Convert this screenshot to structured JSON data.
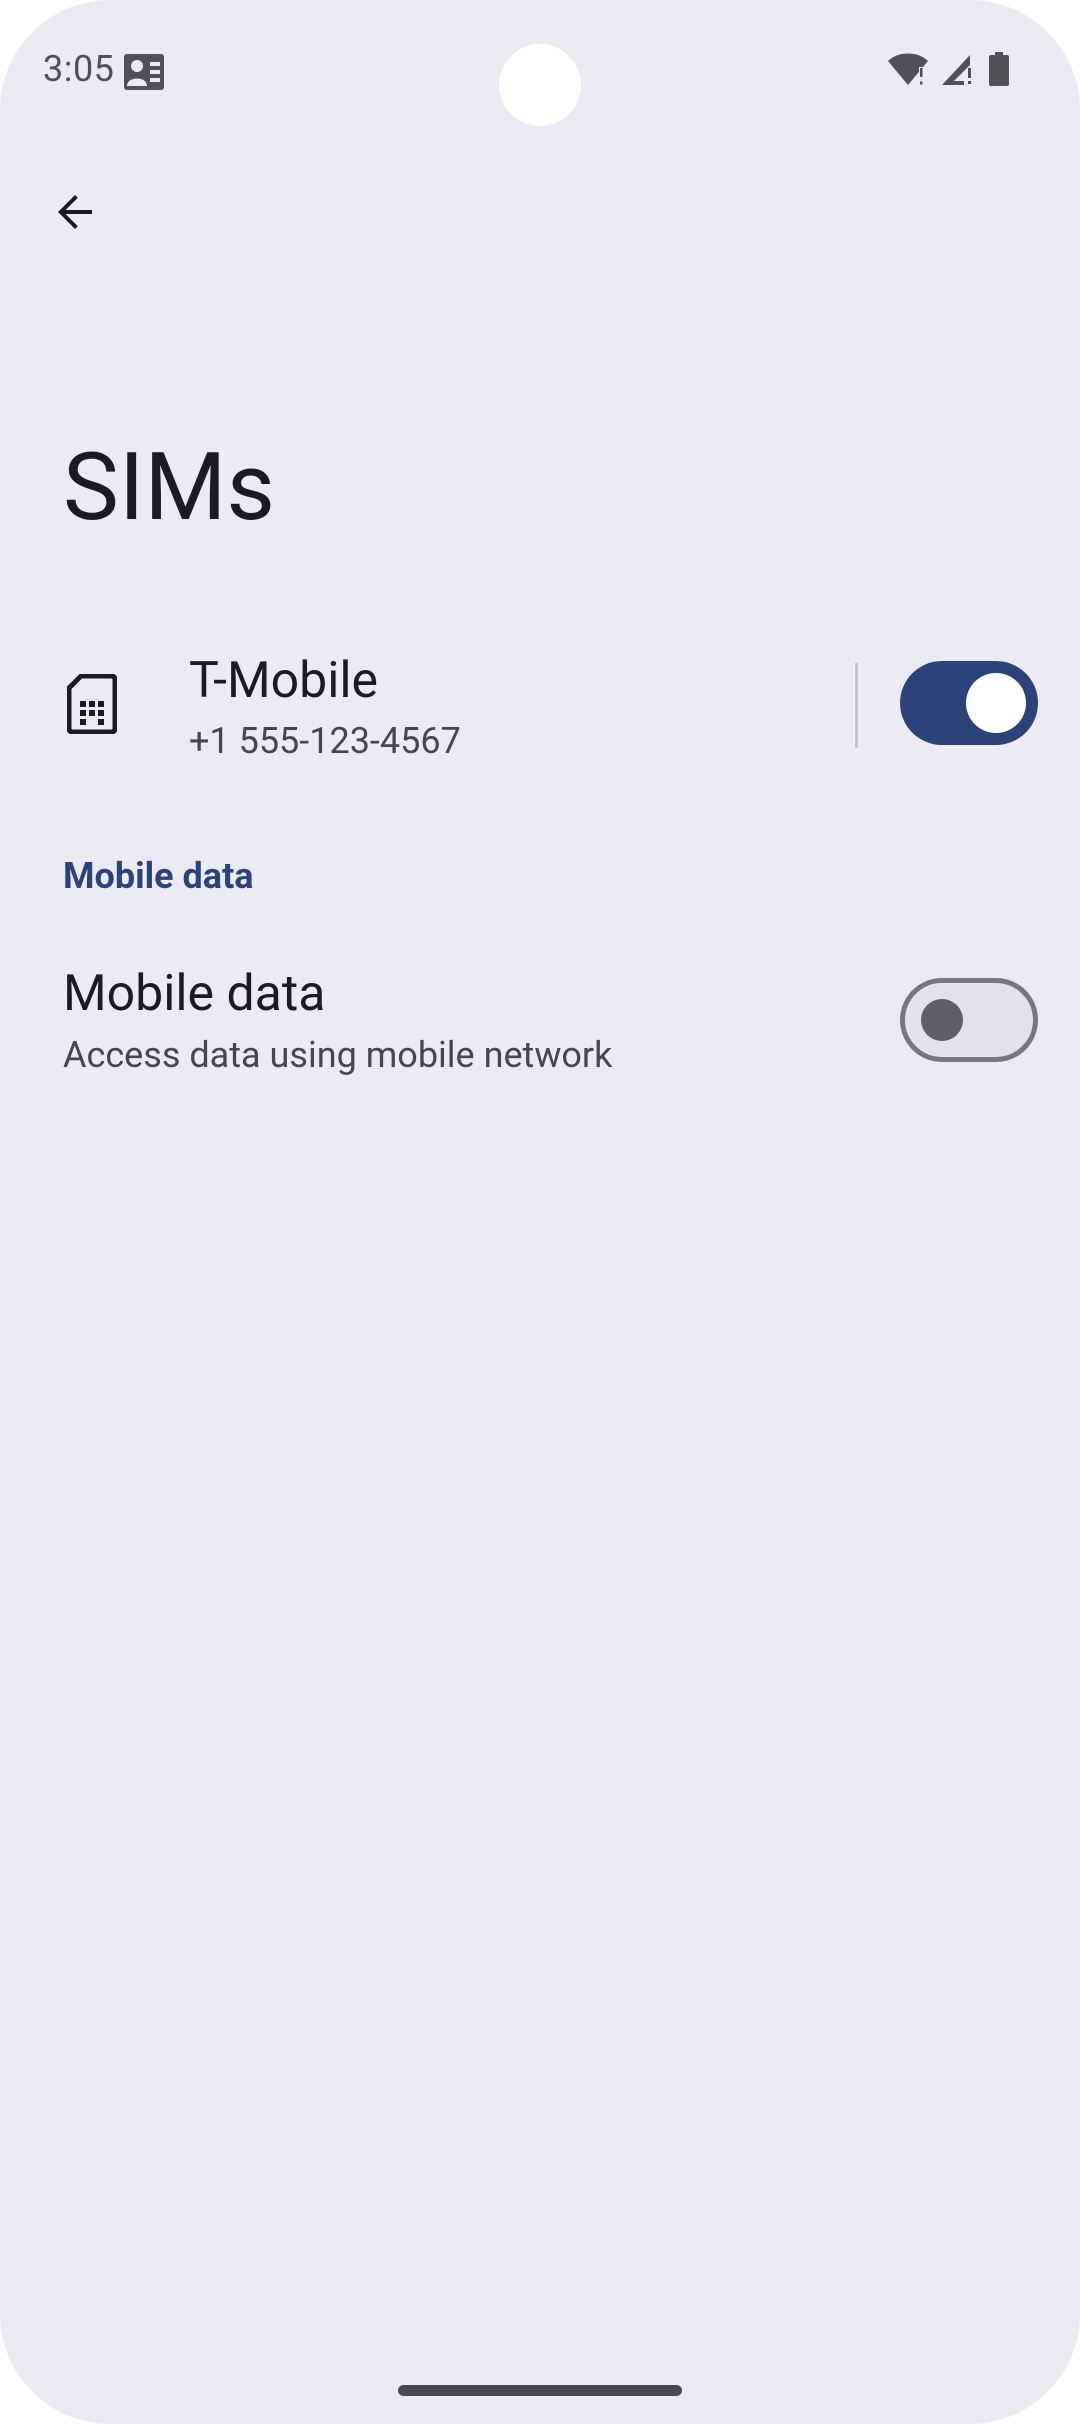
{
  "status_bar": {
    "time": "3:05",
    "icons": [
      "work-profile-icon",
      "wifi-alert-icon",
      "cell-signal-alert-icon",
      "battery-icon"
    ]
  },
  "app_bar": {
    "back_icon": "arrow-back-icon"
  },
  "page": {
    "title": "SIMs"
  },
  "sim": {
    "icon": "sim-card-icon",
    "name": "T-Mobile",
    "number": "+1 555-123-4567",
    "enabled": true
  },
  "section": {
    "header": "Mobile data"
  },
  "mobile_data": {
    "title": "Mobile data",
    "summary": "Access data using mobile network",
    "enabled": false
  },
  "colors": {
    "background": "#ecebf3",
    "accent": "#2c4379",
    "text_primary": "#1b1b21",
    "text_secondary": "#46464f"
  }
}
